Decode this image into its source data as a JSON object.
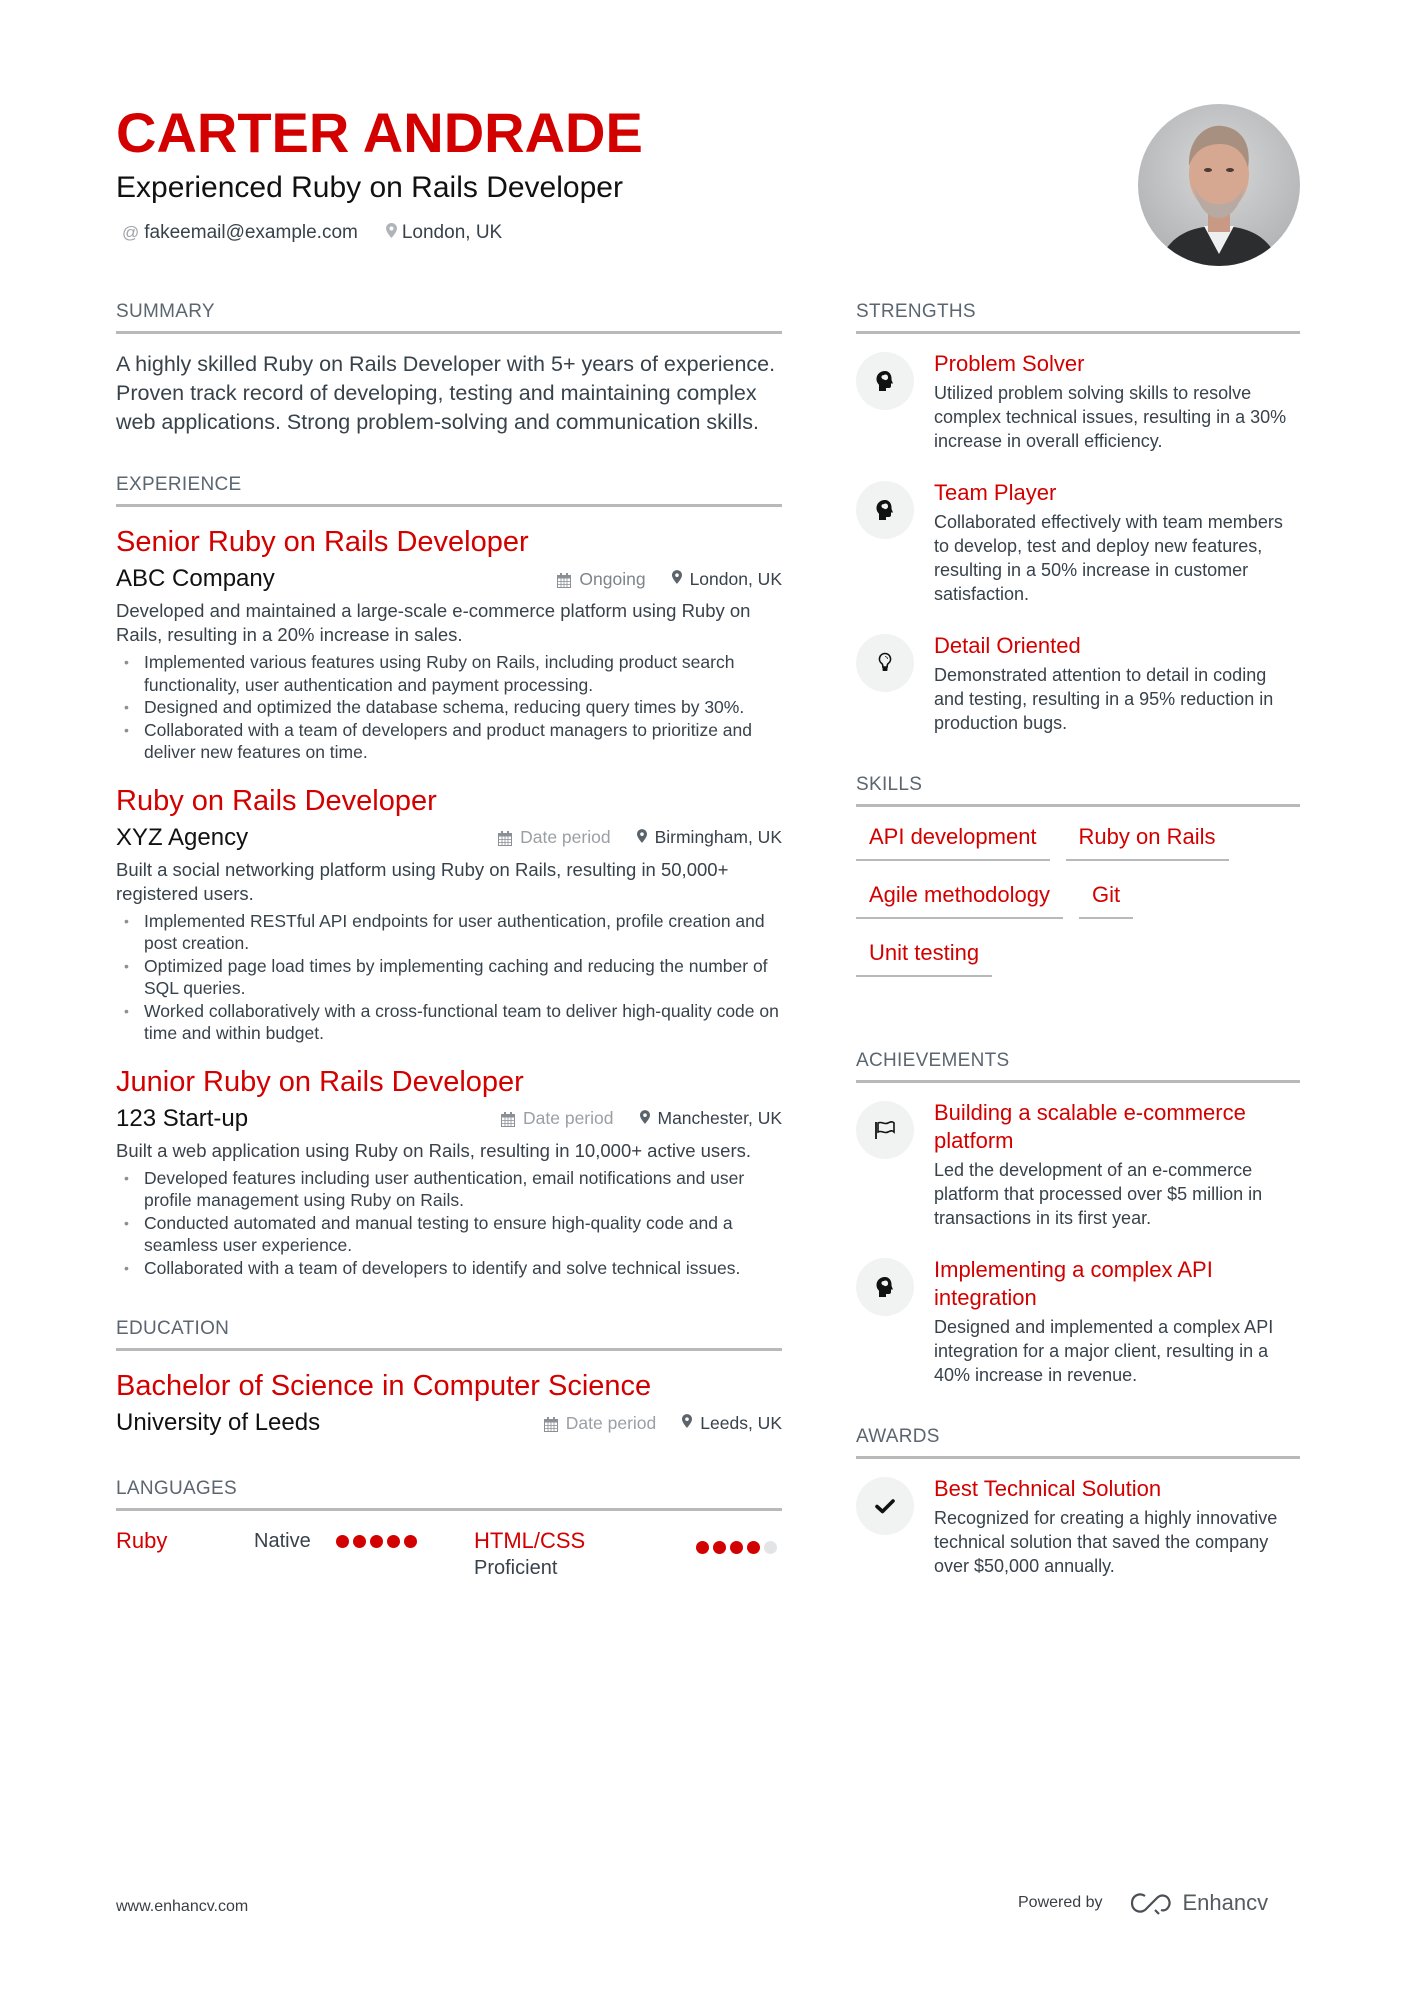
{
  "header": {
    "name": "CARTER ANDRADE",
    "headline": "Experienced Ruby on Rails Developer",
    "email": "fakeemail@example.com",
    "location": "London, UK",
    "photo_alt": "Profile photo"
  },
  "summary": {
    "title": "SUMMARY",
    "text": "A highly skilled Ruby on Rails Developer with 5+ years of experience. Proven track record of developing, testing and maintaining complex web applications. Strong problem-solving and communication skills."
  },
  "experience": {
    "title": "EXPERIENCE",
    "items": [
      {
        "role": "Senior Ruby on Rails Developer",
        "company": "ABC Company",
        "date": "Ongoing",
        "location": "London, UK",
        "description": "Developed and maintained a large-scale e-commerce platform using Ruby on Rails, resulting in a 20% increase in sales.",
        "bullets": [
          "Implemented various features using Ruby on Rails, including product search functionality, user authentication and payment processing.",
          "Designed and optimized the database schema, reducing query times by 30%.",
          "Collaborated with a team of developers and product managers to prioritize and deliver new features on time."
        ]
      },
      {
        "role": "Ruby on Rails Developer",
        "company": "XYZ Agency",
        "date": "Date period",
        "location": "Birmingham, UK",
        "description": "Built a social networking platform using Ruby on Rails, resulting in 50,000+ registered users.",
        "bullets": [
          "Implemented RESTful API endpoints for user authentication, profile creation and post creation.",
          "Optimized page load times by implementing caching and reducing the number of SQL queries.",
          "Worked collaboratively with a cross-functional team to deliver high-quality code on time and within budget."
        ]
      },
      {
        "role": "Junior Ruby on Rails Developer",
        "company": "123 Start-up",
        "date": "Date period",
        "location": "Manchester, UK",
        "description": "Built a web application using Ruby on Rails, resulting in 10,000+ active users.",
        "bullets": [
          "Developed features including user authentication, email notifications and user profile management using Ruby on Rails.",
          "Conducted automated and manual testing to ensure high-quality code and a seamless user experience.",
          "Collaborated with a team of developers to identify and solve technical issues."
        ]
      }
    ]
  },
  "education": {
    "title": "EDUCATION",
    "items": [
      {
        "degree": "Bachelor of Science in Computer Science",
        "school": "University of Leeds",
        "date": "Date period",
        "location": "Leeds, UK"
      }
    ]
  },
  "languages": {
    "title": "LANGUAGES",
    "items": [
      {
        "name": "Ruby",
        "level": "Native",
        "rating": 5,
        "max": 5
      },
      {
        "name": "HTML/CSS",
        "level": "Proficient",
        "rating": 4,
        "max": 5
      }
    ]
  },
  "strengths": {
    "title": "STRENGTHS",
    "items": [
      {
        "icon": "brain-head-icon",
        "title": "Problem Solver",
        "description": "Utilized problem solving skills to resolve complex technical issues, resulting in a 30% increase in overall efficiency."
      },
      {
        "icon": "brain-head-icon",
        "title": "Team Player",
        "description": "Collaborated effectively with team members to develop, test and deploy new features, resulting in a 50% increase in customer satisfaction."
      },
      {
        "icon": "lightbulb-icon",
        "title": "Detail Oriented",
        "description": "Demonstrated attention to detail in coding and testing, resulting in a 95% reduction in production bugs."
      }
    ]
  },
  "skills": {
    "title": "SKILLS",
    "items": [
      "API development",
      "Ruby on Rails",
      "Agile methodology",
      "Git",
      "Unit testing"
    ]
  },
  "achievements": {
    "title": "ACHIEVEMENTS",
    "items": [
      {
        "icon": "flag-icon",
        "title": "Building a scalable e-commerce platform",
        "description": "Led the development of an e-commerce platform that processed over $5 million in transactions in its first year."
      },
      {
        "icon": "brain-head-icon",
        "title": "Implementing a complex API integration",
        "description": "Designed and implemented a complex API integration for a major client, resulting in a 40% increase in revenue."
      }
    ]
  },
  "awards": {
    "title": "AWARDS",
    "items": [
      {
        "icon": "checkmark-icon",
        "title": "Best Technical Solution",
        "description": "Recognized for creating a highly innovative technical solution that saved the company over $50,000 annually."
      }
    ]
  },
  "footer": {
    "website": "www.enhancv.com",
    "powered_by": "Powered by",
    "brand": "Enhancv"
  },
  "colors": {
    "accent": "#d30000",
    "text": "#38424b",
    "divider": "#b7b9bb",
    "icon_bg": "#f1f2f2"
  }
}
